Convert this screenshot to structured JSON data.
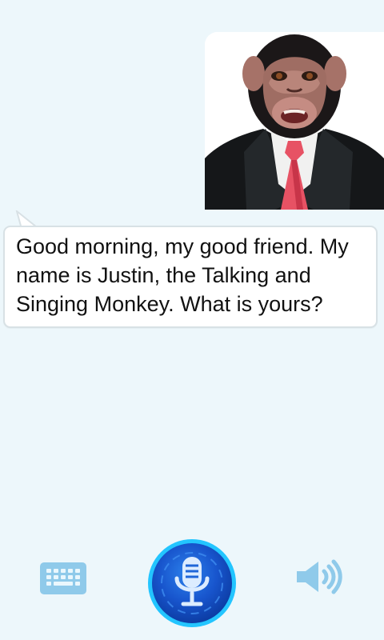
{
  "conversation": {
    "message": "Good morning, my good friend. My name is Justin, the Talking and Singing Monkey. What is yours?"
  },
  "controls": {
    "keyboard_icon": "keyboard-icon",
    "microphone_icon": "microphone-icon",
    "speaker_icon": "speaker-icon"
  },
  "colors": {
    "background": "#edf7fb",
    "bubble_border": "#d8e1e5",
    "icon_blue": "#89c8ea",
    "mic_blue": "#1f66d8",
    "mic_dark": "#0c3ea6",
    "mic_glow": "#22c5ff"
  }
}
